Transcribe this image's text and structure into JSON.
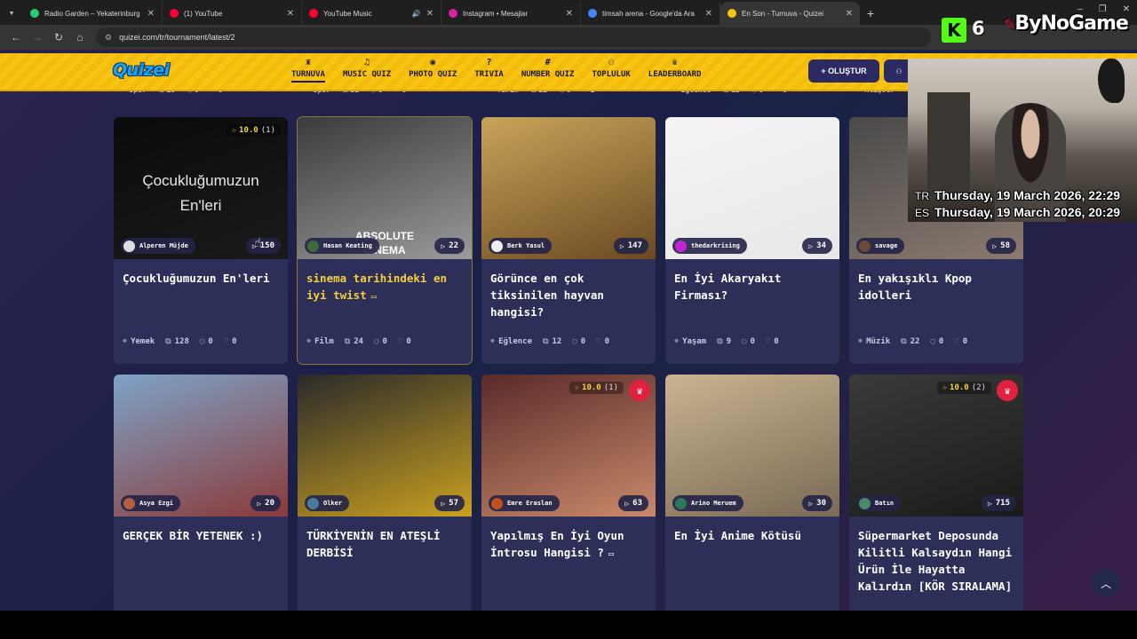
{
  "browser": {
    "tabs": [
      {
        "title": "Radio Garden – Yekaterinburg",
        "favicon_color": "#2ecc71",
        "active": false,
        "audio": false
      },
      {
        "title": "(1) YouTube",
        "favicon_color": "#ff0033",
        "active": false,
        "audio": false
      },
      {
        "title": "YouTube Music",
        "favicon_color": "#ff0033",
        "active": false,
        "audio": true
      },
      {
        "title": "Instagram • Mesajlar",
        "favicon_color": "#d6249f",
        "active": false,
        "audio": false
      },
      {
        "title": "timsah arena - Google'da Ara",
        "favicon_color": "#4285f4",
        "active": false,
        "audio": false
      },
      {
        "title": "En Son - Turnuva - Quizei",
        "favicon_color": "#f8c513",
        "active": true,
        "audio": false
      }
    ],
    "url": "quizei.com/tr/tournament/latest/2",
    "icons": {
      "audio": "🔊",
      "close": "✕",
      "newtab": "+",
      "back": "←",
      "forward": "→",
      "reload": "↻",
      "home": "⌂",
      "tune": "⚙"
    }
  },
  "site": {
    "logo": "Quizei",
    "nav": [
      {
        "label": "TURNUVA",
        "icon": "♜",
        "active": true
      },
      {
        "label": "MUSIC QUIZ",
        "icon": "♫",
        "active": false
      },
      {
        "label": "PHOTO QUIZ",
        "icon": "◉",
        "active": false
      },
      {
        "label": "TRIVIA",
        "icon": "?",
        "active": false
      },
      {
        "label": "NUMBER QUIZ",
        "icon": "#",
        "active": false
      },
      {
        "label": "TOPLULUK",
        "icon": "⚇",
        "active": false
      },
      {
        "label": "LEADERBOARD",
        "icon": "♛",
        "active": false
      }
    ],
    "create_label": "+ OLUŞTUR",
    "user_icon": "⚇"
  },
  "previous_row": [
    {
      "category": "Spor",
      "questions": "19",
      "comments": "0",
      "likes": "0"
    },
    {
      "category": "Spor",
      "questions": "32",
      "comments": "0",
      "likes": "0"
    },
    {
      "category": "Tarih",
      "questions": "21",
      "comments": "0",
      "likes": "1"
    },
    {
      "category": "Eğlence",
      "questions": "12",
      "comments": "0",
      "likes": "0"
    },
    {
      "category": "Alişver",
      "questions": "",
      "comments": "",
      "likes": ""
    }
  ],
  "cards": [
    {
      "title": "Çocukluğumuzun En'leri",
      "thumb_text": "Çocukluğumuzun\nEn'leri",
      "rating": "10.0",
      "rating_count": "(1)",
      "crown": false,
      "author": "Alperen Müjde",
      "plays": "150",
      "category": "Yemek",
      "questions": "128",
      "comments": "0",
      "likes": "0",
      "gold": false,
      "colors": [
        "#0b0b0b",
        "#1a1a1a"
      ]
    },
    {
      "title": "sinema tarihindeki en iyi twist",
      "thumb_text": "ABSOLUTE\nCINEMA",
      "rating": "",
      "rating_count": "",
      "crown": false,
      "author": "Hasan Keating",
      "plays": "22",
      "category": "Film",
      "questions": "24",
      "comments": "0",
      "likes": "0",
      "gold": true,
      "video": true,
      "colors": [
        "#3b3b3b",
        "#9a9a9a"
      ]
    },
    {
      "title": "Görünce en çok tiksinilen hayvan hangisi?",
      "thumb_text": "",
      "rating": "",
      "rating_count": "",
      "crown": false,
      "author": "Berk Yasul",
      "plays": "147",
      "category": "Eğlence",
      "questions": "12",
      "comments": "0",
      "likes": "0",
      "gold": false,
      "colors": [
        "#c8a45a",
        "#6b4a22"
      ]
    },
    {
      "title": "En İyi Akaryakıt Firması?",
      "thumb_text": "",
      "rating": "",
      "rating_count": "",
      "crown": false,
      "author": "thedarkrising",
      "plays": "34",
      "category": "Yaşam",
      "questions": "9",
      "comments": "0",
      "likes": "0",
      "gold": false,
      "colors": [
        "#f4f4f4",
        "#e8e8e8"
      ]
    },
    {
      "title": "En yakışıklı Kpop idolleri",
      "thumb_text": "",
      "rating": "",
      "rating_count": "",
      "crown": false,
      "author": "savage",
      "plays": "58",
      "category": "Müzik",
      "questions": "22",
      "comments": "0",
      "likes": "0",
      "gold": false,
      "colors": [
        "#4a4a4a",
        "#8a7a70"
      ]
    },
    {
      "title": "GERÇEK BİR YETENEK :)",
      "thumb_text": "",
      "rating": "",
      "rating_count": "",
      "crown": false,
      "author": "Asya Ezgi",
      "plays": "20",
      "category": "",
      "questions": "",
      "comments": "",
      "likes": "",
      "gold": false,
      "colors": [
        "#7ea3c7",
        "#8a3a3a"
      ]
    },
    {
      "title": "TÜRKİYENİN EN ATEŞLİ DERBİSİ",
      "thumb_text": "",
      "rating": "",
      "rating_count": "",
      "crown": false,
      "author": "Olker",
      "plays": "57",
      "category": "",
      "questions": "",
      "comments": "",
      "likes": "",
      "gold": false,
      "colors": [
        "#2a2a2a",
        "#c9a020"
      ]
    },
    {
      "title": "Yapılmış En İyi Oyun İntrosu Hangisi ?",
      "thumb_text": "",
      "rating": "10.0",
      "rating_count": "(1)",
      "crown": true,
      "author": "Emre Eraslan",
      "plays": "63",
      "category": "",
      "questions": "",
      "comments": "",
      "likes": "",
      "gold": false,
      "video": true,
      "colors": [
        "#5a2a2a",
        "#c98a6a"
      ]
    },
    {
      "title": "En İyi Anime Kötüsü",
      "thumb_text": "",
      "rating": "",
      "rating_count": "",
      "crown": false,
      "author": "Arino Meruem",
      "plays": "30",
      "category": "",
      "questions": "",
      "comments": "",
      "likes": "",
      "gold": false,
      "colors": [
        "#c9b490",
        "#7a6a55"
      ]
    },
    {
      "title": "Süpermarket Deposunda Kilitli Kalsaydın Hangi Ürün İle Hayatta Kalırdın [KÖR SIRALAMA]",
      "thumb_text": "",
      "rating": "10.0",
      "rating_count": "(2)",
      "crown": true,
      "author": "Batın",
      "plays": "715",
      "category": "",
      "questions": "",
      "comments": "",
      "likes": "",
      "gold": false,
      "colors": [
        "#3a3a3a",
        "#1a1a1a"
      ]
    }
  ],
  "overlay": {
    "brand_k": "K",
    "brand_num": "6",
    "brand_name": "ByNoGame",
    "clock": [
      {
        "tz": "TR",
        "text": "Thursday, 19 March 2026, 22:29"
      },
      {
        "tz": "ES",
        "text": "Thursday, 19 March 2026, 20:29"
      }
    ]
  },
  "icons": {
    "star": "☆",
    "crown": "♛",
    "play": "▷",
    "questions": "⧉",
    "comment": "◯",
    "heart": "♡",
    "category": "⌖",
    "video": "▭",
    "scroll_top": "︿",
    "cursor": "☝"
  }
}
